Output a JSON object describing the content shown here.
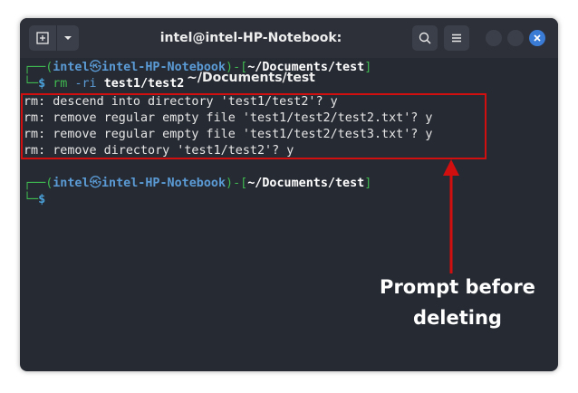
{
  "window": {
    "title": "intel@intel-HP-Notebook: ~/Documents/test"
  },
  "terminal": {
    "prompt1": {
      "corner": "┌──",
      "open": "(",
      "user": "intel",
      "at": "㉿",
      "host": "intel-HP-Notebook",
      "close": ")",
      "dash": "-[",
      "path": "~/Documents/test",
      "end": "]",
      "corner2": "└─",
      "dollar": "$",
      "cmd": "rm",
      "flag": "-ri",
      "arg": "test1/test2"
    },
    "output": [
      "rm: descend into directory 'test1/test2'? y",
      "rm: remove regular empty file 'test1/test2/test2.txt'? y",
      "rm: remove regular empty file 'test1/test2/test3.txt'? y",
      "rm: remove directory 'test1/test2'? y"
    ],
    "prompt2": {
      "corner": "┌──",
      "open": "(",
      "user": "intel",
      "at": "㉿",
      "host": "intel-HP-Notebook",
      "close": ")",
      "dash": "-[",
      "path": "~/Documents/test",
      "end": "]",
      "corner2": "└─",
      "dollar": "$"
    }
  },
  "annotation": {
    "line1": "Prompt before",
    "line2": "deleting",
    "color": "#d20f0f"
  },
  "icons": {
    "new_tab": "new-tab-icon",
    "dropdown": "chevron-down-icon",
    "search": "search-icon",
    "menu": "hamburger-menu-icon",
    "close": "close-icon"
  }
}
